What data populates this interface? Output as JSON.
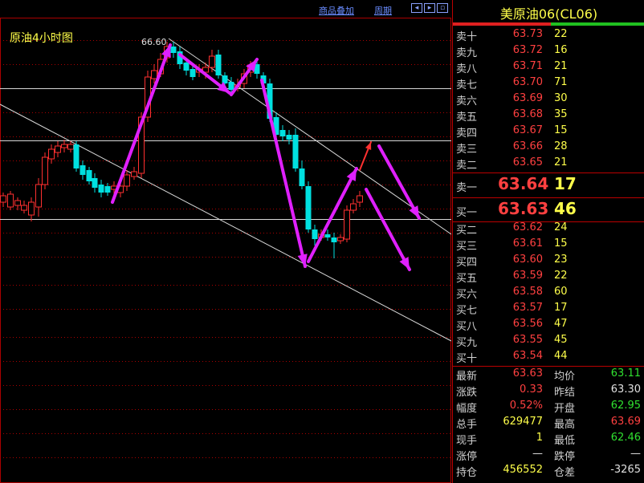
{
  "chart": {
    "title": "原油4小时图",
    "high_label": "66.60",
    "toolbar": {
      "overlay": "商品叠加",
      "period": "周期"
    }
  },
  "quote": {
    "title": "美原油06(CL06)",
    "asks": [
      {
        "label": "卖十",
        "price": "63.73",
        "vol": "22"
      },
      {
        "label": "卖九",
        "price": "63.72",
        "vol": "16"
      },
      {
        "label": "卖八",
        "price": "63.71",
        "vol": "21"
      },
      {
        "label": "卖七",
        "price": "63.70",
        "vol": "71"
      },
      {
        "label": "卖六",
        "price": "63.69",
        "vol": "30"
      },
      {
        "label": "卖五",
        "price": "63.68",
        "vol": "35"
      },
      {
        "label": "卖四",
        "price": "63.67",
        "vol": "15"
      },
      {
        "label": "卖三",
        "price": "63.66",
        "vol": "28"
      },
      {
        "label": "卖二",
        "price": "63.65",
        "vol": "21"
      }
    ],
    "ask1": {
      "label": "卖一",
      "price": "63.64",
      "vol": "17"
    },
    "bid1": {
      "label": "买一",
      "price": "63.63",
      "vol": "46"
    },
    "bids": [
      {
        "label": "买二",
        "price": "63.62",
        "vol": "24"
      },
      {
        "label": "买三",
        "price": "63.61",
        "vol": "15"
      },
      {
        "label": "买四",
        "price": "63.60",
        "vol": "23"
      },
      {
        "label": "买五",
        "price": "63.59",
        "vol": "22"
      },
      {
        "label": "买六",
        "price": "63.58",
        "vol": "60"
      },
      {
        "label": "买七",
        "price": "63.57",
        "vol": "17"
      },
      {
        "label": "买八",
        "price": "63.56",
        "vol": "47"
      },
      {
        "label": "买九",
        "price": "63.55",
        "vol": "45"
      },
      {
        "label": "买十",
        "price": "63.54",
        "vol": "44"
      }
    ],
    "stats": [
      {
        "l1": "最新",
        "v1": "63.63",
        "c1": "red",
        "l2": "均价",
        "v2": "63.11",
        "c2": "green"
      },
      {
        "l1": "涨跌",
        "v1": "0.33",
        "c1": "red",
        "l2": "昨结",
        "v2": "63.30",
        "c2": "white"
      },
      {
        "l1": "幅度",
        "v1": "0.52%",
        "c1": "red",
        "l2": "开盘",
        "v2": "62.95",
        "c2": "green"
      },
      {
        "l1": "总手",
        "v1": "629477",
        "c1": "yellow",
        "l2": "最高",
        "v2": "63.69",
        "c2": "red"
      },
      {
        "l1": "现手",
        "v1": "1",
        "c1": "yellow",
        "l2": "最低",
        "v2": "62.46",
        "c2": "green"
      },
      {
        "l1": "涨停",
        "v1": "—",
        "c1": "white",
        "l2": "跌停",
        "v2": "—",
        "c2": "white"
      },
      {
        "l1": "持仓",
        "v1": "456552",
        "c1": "yellow",
        "l2": "仓差",
        "v2": "-3265",
        "c2": "white"
      }
    ]
  },
  "colors": {
    "up": "#ff3030",
    "down": "#00e0e0",
    "arrow": "#e020ff",
    "ask": "#ff4040",
    "vol": "#ffff4a"
  }
}
